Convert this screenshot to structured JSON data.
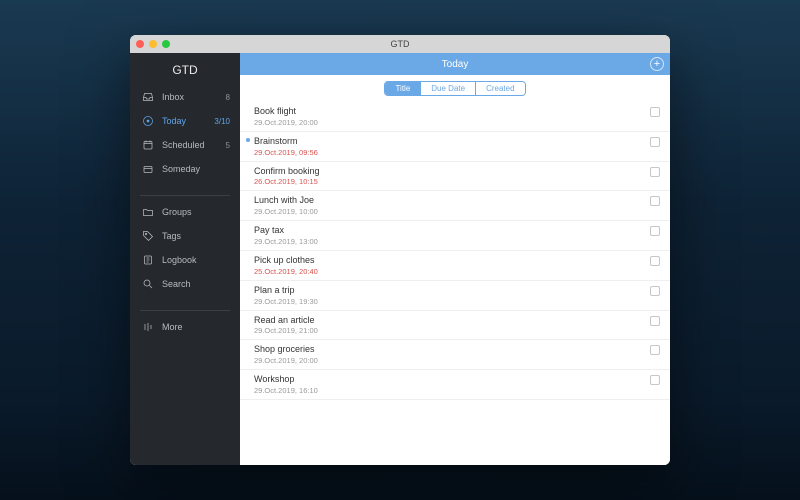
{
  "window": {
    "title": "GTD"
  },
  "sidebar": {
    "title": "GTD",
    "primary": [
      {
        "icon": "inbox",
        "label": "Inbox",
        "count": "8"
      },
      {
        "icon": "today",
        "label": "Today",
        "count": "3/10",
        "active": true
      },
      {
        "icon": "scheduled",
        "label": "Scheduled",
        "count": "5"
      },
      {
        "icon": "someday",
        "label": "Someday",
        "count": ""
      }
    ],
    "secondary": [
      {
        "icon": "groups",
        "label": "Groups"
      },
      {
        "icon": "tags",
        "label": "Tags"
      },
      {
        "icon": "logbook",
        "label": "Logbook"
      },
      {
        "icon": "search",
        "label": "Search"
      }
    ],
    "tertiary": [
      {
        "icon": "more",
        "label": "More"
      }
    ]
  },
  "header": {
    "title": "Today"
  },
  "sort_tabs": [
    "Title",
    "Due Date",
    "Created"
  ],
  "sort_selected": 0,
  "tasks": [
    {
      "title": "Book flight",
      "due": "29.Oct.2019, 20:00",
      "overdue": false,
      "flag": false
    },
    {
      "title": "Brainstorm",
      "due": "29.Oct.2019, 09:56",
      "overdue": true,
      "flag": true
    },
    {
      "title": "Confirm booking",
      "due": "26.Oct.2019, 10:15",
      "overdue": true,
      "flag": false
    },
    {
      "title": "Lunch with Joe",
      "due": "29.Oct.2019, 10:00",
      "overdue": false,
      "flag": false
    },
    {
      "title": "Pay tax",
      "due": "29.Oct.2019, 13:00",
      "overdue": false,
      "flag": false
    },
    {
      "title": "Pick up clothes",
      "due": "25.Oct.2019, 20:40",
      "overdue": true,
      "flag": false
    },
    {
      "title": "Plan a trip",
      "due": "29.Oct.2019, 19:30",
      "overdue": false,
      "flag": false
    },
    {
      "title": "Read an article",
      "due": "29.Oct.2019, 21:00",
      "overdue": false,
      "flag": false
    },
    {
      "title": "Shop groceries",
      "due": "29.Oct.2019, 20:00",
      "overdue": false,
      "flag": false
    },
    {
      "title": "Workshop",
      "due": "29.Oct.2019, 16:10",
      "overdue": false,
      "flag": false
    }
  ]
}
